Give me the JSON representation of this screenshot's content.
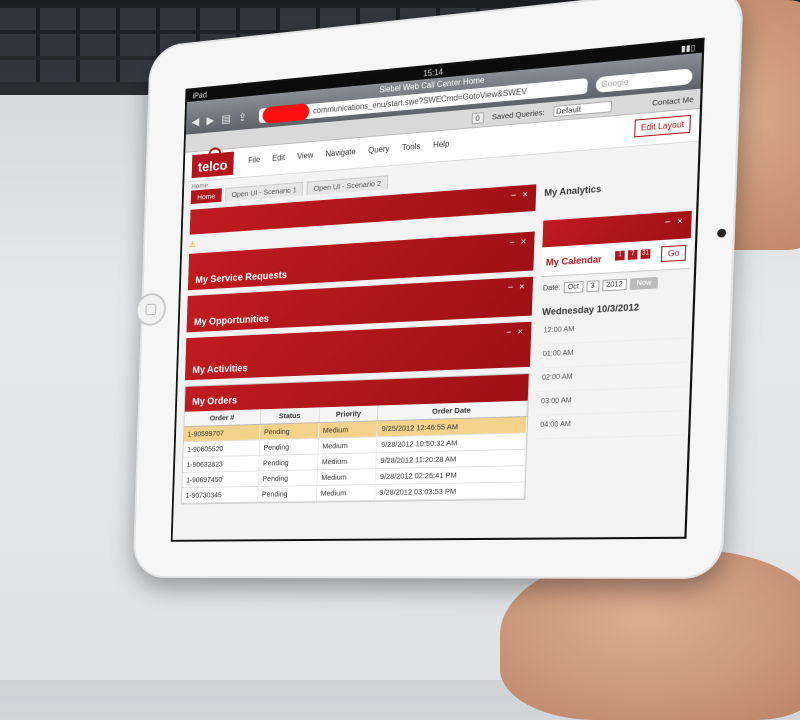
{
  "device": {
    "carrier": "iPad",
    "time": "15:14"
  },
  "safari": {
    "page_title": "Siebel Web Call Center Home",
    "url": "communications_enu/start.swe?SWECmd=GotoView&SWEV",
    "search_placeholder": "Google",
    "back_icon": "chevron-left-icon",
    "forward_icon": "chevron-right-icon"
  },
  "siebel_bar": {
    "queue_count": "0",
    "saved_queries_label": "Saved Queries:",
    "saved_queries_value": "Default",
    "contact_label": "Contact Me"
  },
  "app": {
    "logo_text": "telco",
    "menu": [
      "File",
      "Edit",
      "View",
      "Navigate",
      "Query",
      "Tools",
      "Help"
    ],
    "edit_layout_label": "Edit Layout",
    "breadcrumb": "Home",
    "tabs": [
      "Home",
      "Open UI - Scenario 1",
      "Open UI - Scenario 2"
    ]
  },
  "applets": {
    "service_requests": "My Service Requests",
    "opportunities": "My Opportunities",
    "activities": "My Activities",
    "orders": "My Orders",
    "analytics": "My Analytics",
    "calendar": "My Calendar"
  },
  "orders": {
    "columns": [
      "Order #",
      "Status",
      "Priority",
      "Order Date"
    ],
    "rows": [
      {
        "order": "1-90599707",
        "status": "Pending",
        "priority": "Medium",
        "date": "9/25/2012 12:46:55 AM"
      },
      {
        "order": "1-90605520",
        "status": "Pending",
        "priority": "Medium",
        "date": "9/28/2012 10:50:32 AM"
      },
      {
        "order": "1-90632823",
        "status": "Pending",
        "priority": "Medium",
        "date": "9/28/2012 11:20:28 AM"
      },
      {
        "order": "1-90697450",
        "status": "Pending",
        "priority": "Medium",
        "date": "9/28/2012 02:25:41 PM"
      },
      {
        "order": "1-90730345",
        "status": "Pending",
        "priority": "Medium",
        "date": "9/28/2012 03:03:53 PM"
      }
    ]
  },
  "calendar": {
    "date_label": "Date:",
    "month": "Oct",
    "day": "3",
    "year": "2012",
    "go_label": "Go",
    "now_label": "Now",
    "day_heading": "Wednesday 10/3/2012",
    "slots": [
      "12:00 AM",
      "01:00 AM",
      "02:00 AM",
      "03:00 AM",
      "04:00 AM"
    ]
  }
}
